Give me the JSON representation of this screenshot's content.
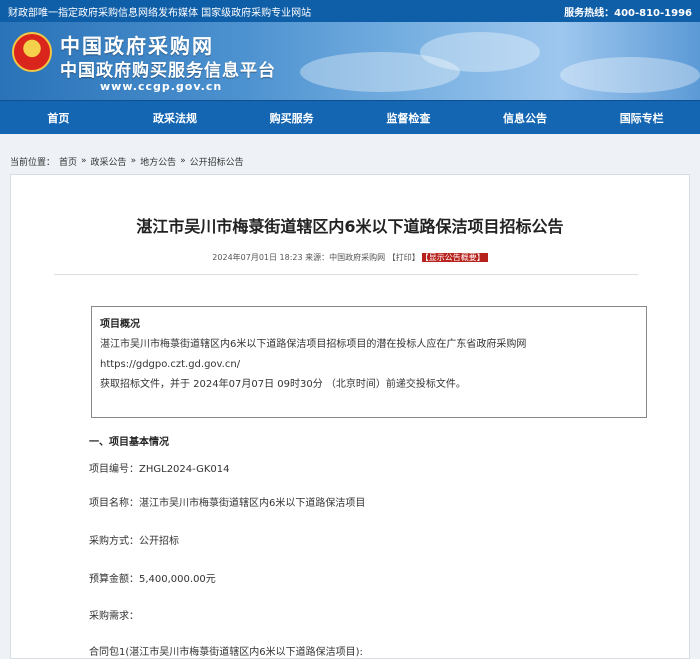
{
  "topbar": {
    "left_text": "财政部唯一指定政府采购信息网络发布媒体  国家级政府采购专业网站",
    "right_text": "服务热线：400-810-1996"
  },
  "header": {
    "title": "中国政府采购网",
    "subtitle": "中国政府购买服务信息平台",
    "url": "www.ccgp.gov.cn"
  },
  "nav": [
    "首页",
    "政采法规",
    "购买服务",
    "监督检查",
    "信息公告",
    "国际专栏"
  ],
  "breadcrumb": {
    "prefix": "当前位置：",
    "items": [
      "首页",
      "政采公告",
      "地方公告",
      "公开招标公告"
    ],
    "separator": "»"
  },
  "article": {
    "title": "湛江市吴川市梅菉街道辖区内6米以下道路保洁项目招标公告",
    "meta": "2024年07月01日 18:23 来源：中国政府采购网 【打印】",
    "meta_tag": "【显示公告概要】",
    "overview": {
      "heading": "项目概况",
      "line1": "湛江市吴川市梅菉街道辖区内6米以下道路保洁项目招标项目的潜在投标人应在广东省政府采购网",
      "line2": "https://gdgpo.czt.gd.gov.cn/",
      "line3": "获取招标文件，并于 2024年07月07日 09时30分 （北京时间）前递交投标文件。"
    },
    "section_heading": "一、项目基本情况",
    "fields": [
      "项目编号：ZHGL2024-GK014",
      "项目名称：湛江市吴川市梅菉街道辖区内6米以下道路保洁项目",
      "采购方式：公开招标",
      "预算金额：5,400,000.00元",
      "采购需求：",
      "合同包1(湛江市吴川市梅菉街道辖区内6米以下道路保洁项目):"
    ]
  }
}
